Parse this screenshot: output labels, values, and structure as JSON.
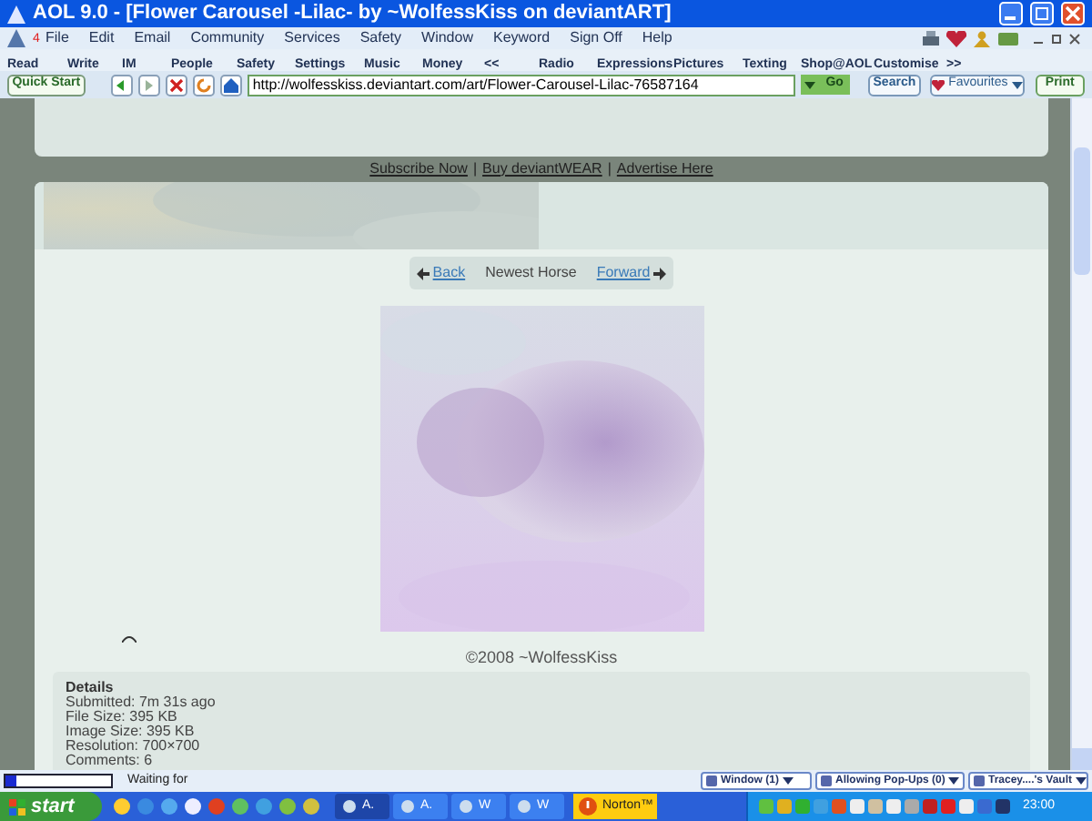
{
  "window": {
    "title": "AOL 9.0 - [Flower Carousel -Lilac- by ~WolfessKiss on deviantART]"
  },
  "menu": [
    "File",
    "Edit",
    "Email",
    "Community",
    "Services",
    "Safety",
    "Window",
    "Keyword",
    "Sign Off",
    "Help"
  ],
  "toolbar": [
    {
      "label": "Read",
      "badge": "4"
    },
    {
      "label": "Write"
    },
    {
      "label": "IM"
    },
    {
      "label": "People"
    },
    {
      "label": "Safety"
    },
    {
      "label": "Settings"
    },
    {
      "label": "Music"
    },
    {
      "label": "Money"
    },
    {
      "label": "<<"
    },
    {
      "label": "Radio"
    },
    {
      "label": "Expressions"
    },
    {
      "label": "Pictures"
    },
    {
      "label": "Texting"
    },
    {
      "label": "Shop@AOL"
    },
    {
      "label": "Customise"
    },
    {
      "label": ">>"
    }
  ],
  "navbar": {
    "quick_start": "Quick Start",
    "address": "http://wolfesskiss.deviantart.com/art/Flower-Carousel-Lilac-76587164",
    "go": "Go",
    "search": "Search",
    "favourites": "Favourites",
    "print": "Print"
  },
  "page": {
    "footer_links": [
      "Subscribe Now",
      "Buy deviantWEAR",
      "Advertise Here"
    ],
    "separator": "|",
    "nav": {
      "back": "Back",
      "title": "Newest Horse",
      "forward": "Forward"
    },
    "artwork": {
      "kind": "picture"
    },
    "copyright": "©2008 ~WolfessKiss",
    "details": {
      "heading": "Details",
      "lines": [
        "Submitted: 7m 31s ago",
        "File Size: 395 KB",
        "Image Size: 395 KB",
        "Resolution: 700×700",
        "Comments: 6"
      ]
    }
  },
  "status_bar": {
    "text": "Waiting for",
    "level": 0.1,
    "buttons": [
      "Window (1)",
      "Allowing Pop-Ups (0)",
      "Tracey....'s Vault"
    ]
  },
  "taskbar": {
    "start": "start",
    "tasks": [
      {
        "label": "A.",
        "selected": true
      },
      {
        "label": "A.",
        "selected": false
      },
      {
        "label": "W",
        "selected": false
      },
      {
        "label": "W",
        "selected": false
      }
    ],
    "norton": "Norton™",
    "clock": "23:00"
  }
}
